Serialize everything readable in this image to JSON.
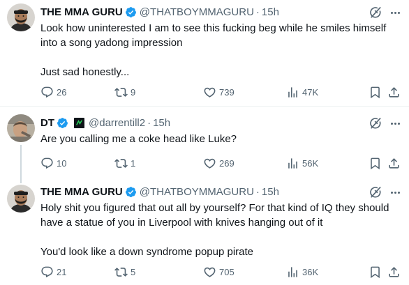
{
  "tweets": [
    {
      "name": "THE MMA GURU",
      "handle": "@THATBOYMMAGURU",
      "dot": "·",
      "time": "15h",
      "text_lines": [
        "Look how uninterested I am to see this fucking beg while he smiles himself",
        "into a song yadong impression",
        "",
        "Just sad honestly..."
      ],
      "replies": "26",
      "retweets": "9",
      "likes": "739",
      "views": "47K"
    },
    {
      "name": "DT",
      "handle": "@darrentill2",
      "dot": "·",
      "time": "15h",
      "text_lines": [
        "Are you calling me a coke head like Luke?"
      ],
      "replies": "10",
      "retweets": "1",
      "likes": "269",
      "views": "56K"
    },
    {
      "name": "THE MMA GURU",
      "handle": "@THATBOYMMAGURU",
      "dot": "·",
      "time": "15h",
      "text_lines": [
        "Holy shit you figured that out all by yourself? For that kind of IQ they should",
        "have a statue of you in Liverpool with knives hanging out of it",
        "",
        "You'd look like a down syndrome popup pirate"
      ],
      "replies": "21",
      "retweets": "5",
      "likes": "705",
      "views": "36K"
    }
  ],
  "icons": {
    "verified": "verified-badge-icon",
    "affiliate": "affiliate-badge-icon",
    "grok": "grok-icon",
    "more": "more-icon",
    "reply": "reply-icon",
    "retweet": "retweet-icon",
    "like": "heart-icon",
    "views": "views-icon",
    "bookmark": "bookmark-icon",
    "share": "share-icon"
  },
  "colors": {
    "verified_blue": "#1d9bf0",
    "secondary_text": "#536471",
    "thread_line": "#cfd9de"
  }
}
